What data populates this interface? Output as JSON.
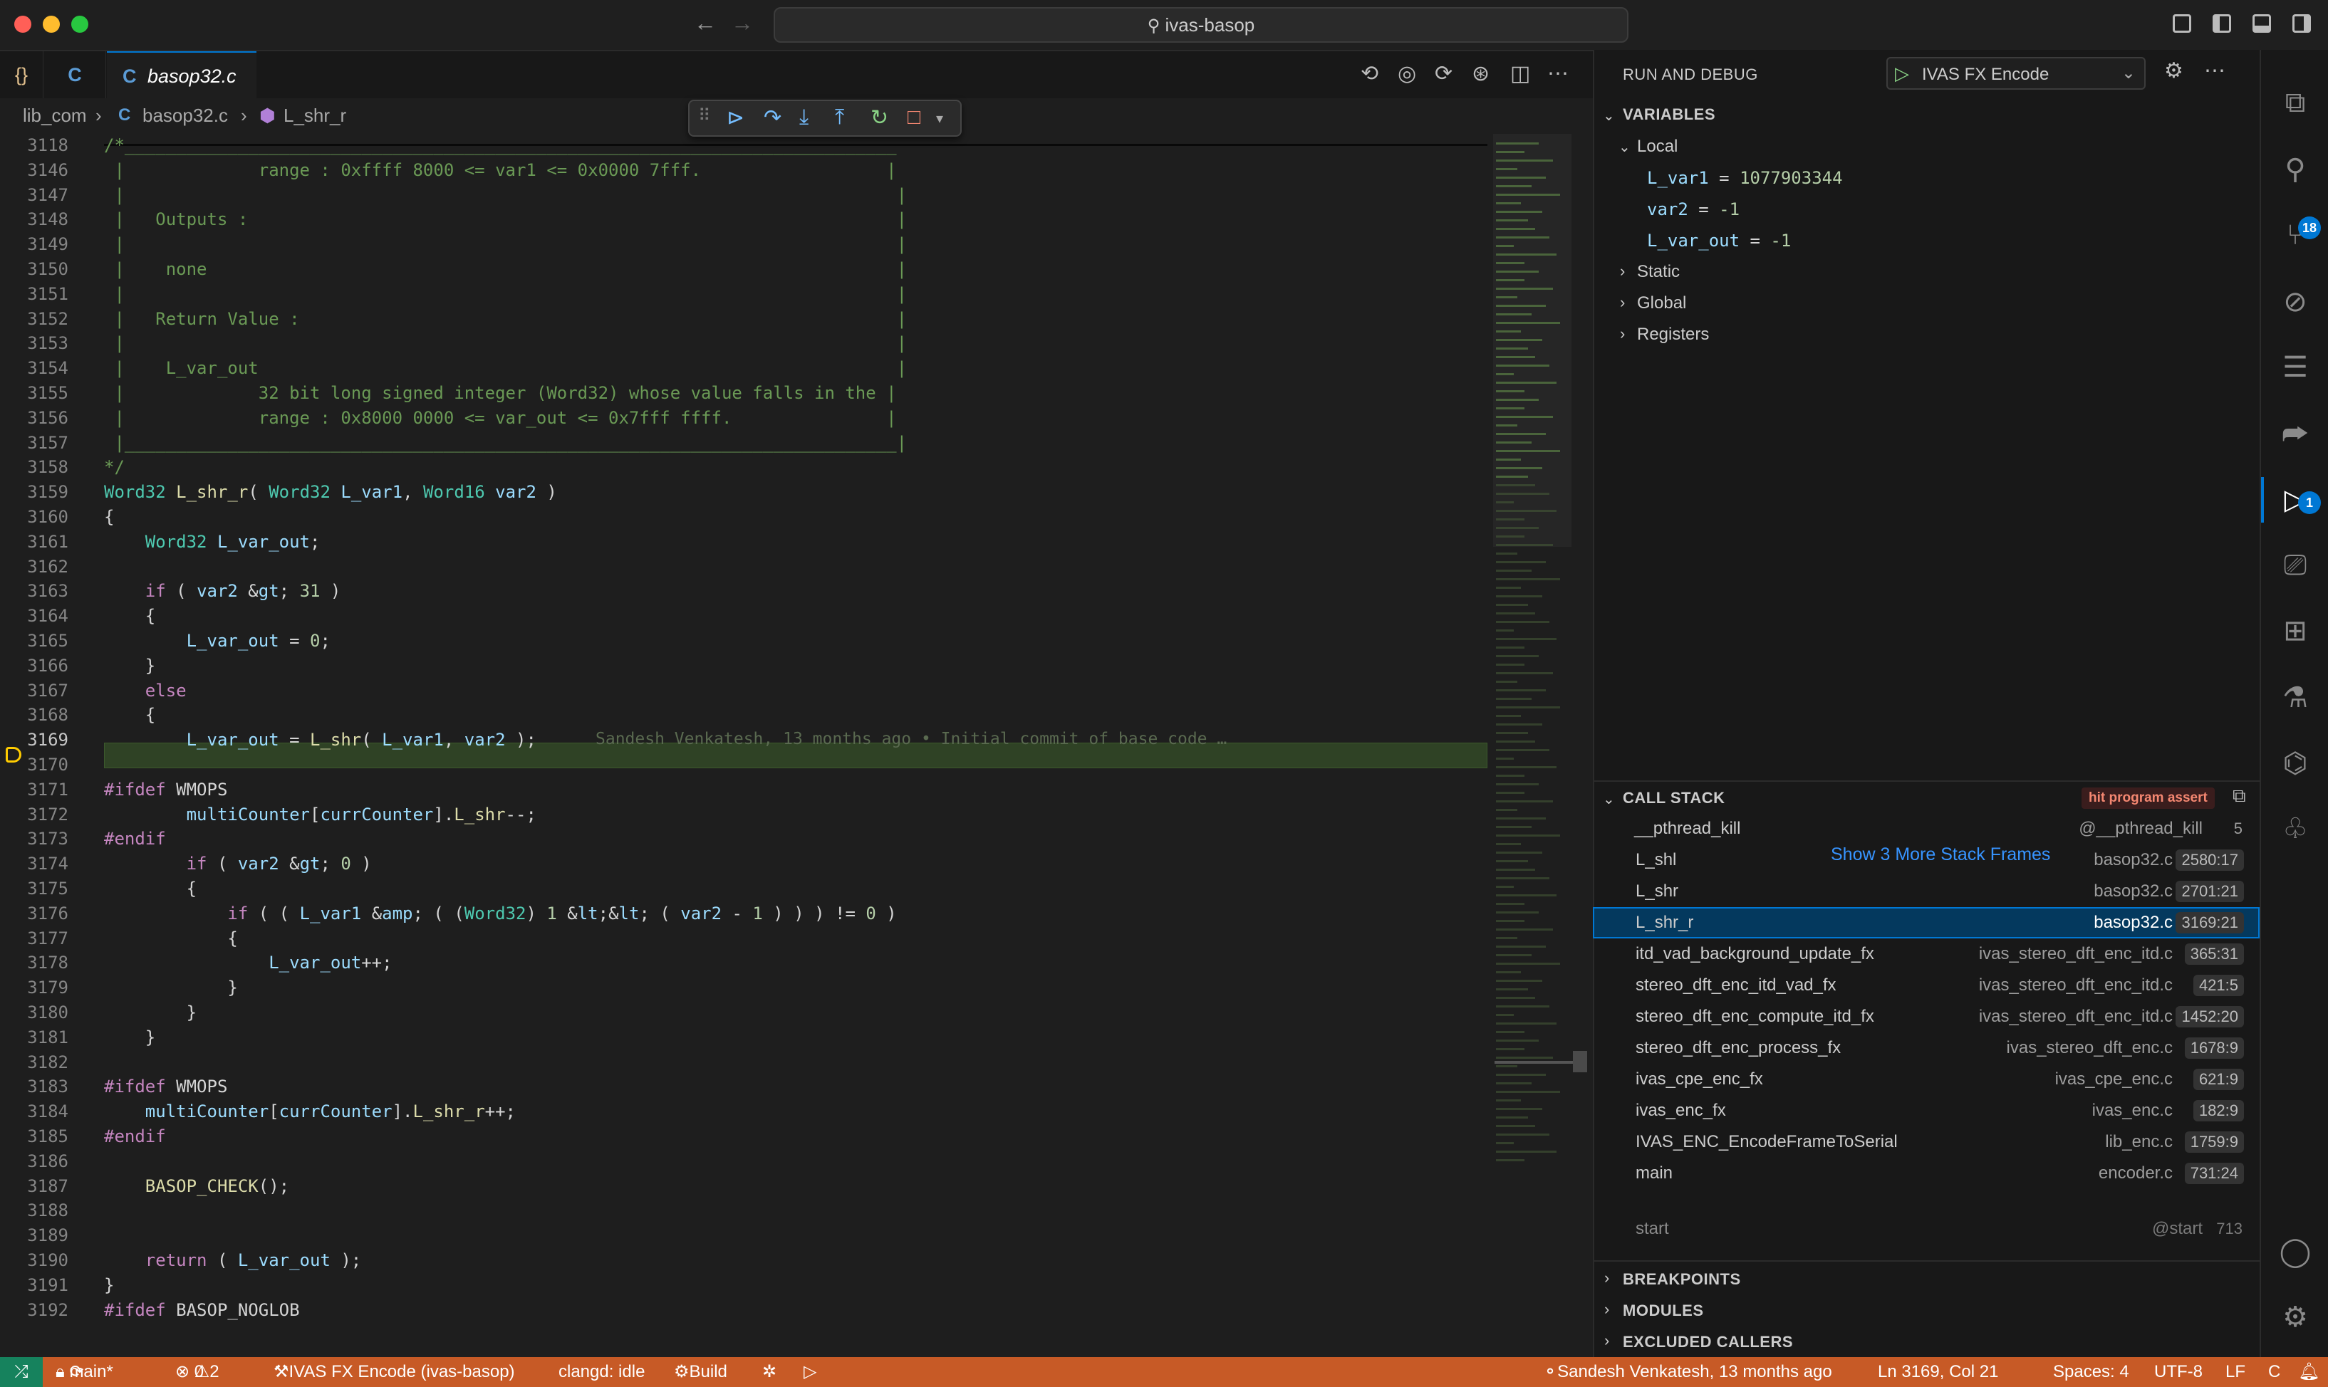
{
  "titlebar": {
    "search_text": "ivas-basop",
    "colors": {
      "close": "#ff5f57",
      "minimize": "#febc2e",
      "maximize": "#28c840"
    }
  },
  "tabs": [
    {
      "label": "{}"
    },
    {
      "label": "C"
    },
    {
      "label": "basop32.c"
    }
  ],
  "breadcrumb": {
    "folder": "lib_com",
    "file": "basop32.c",
    "symbol": "L_shr_r"
  },
  "editor": {
    "lines": [
      {
        "n": "3118",
        "t": "/*___________________________________________________________________________"
      },
      {
        "n": "3146",
        "t": " |             range : 0xffff 8000 <= var1 <= 0x0000 7fff.                  |"
      },
      {
        "n": "3147",
        "t": " |                                                                           |"
      },
      {
        "n": "3148",
        "t": " |   Outputs :                                                               |"
      },
      {
        "n": "3149",
        "t": " |                                                                           |"
      },
      {
        "n": "3150",
        "t": " |    none                                                                   |"
      },
      {
        "n": "3151",
        "t": " |                                                                           |"
      },
      {
        "n": "3152",
        "t": " |   Return Value :                                                          |"
      },
      {
        "n": "3153",
        "t": " |                                                                           |"
      },
      {
        "n": "3154",
        "t": " |    L_var_out                                                              |"
      },
      {
        "n": "3155",
        "t": " |             32 bit long signed integer (Word32) whose value falls in the |"
      },
      {
        "n": "3156",
        "t": " |             range : 0x8000 0000 <= var_out <= 0x7fff ffff.               |"
      },
      {
        "n": "3157",
        "t": " |___________________________________________________________________________|"
      },
      {
        "n": "3158",
        "t": "*/"
      },
      {
        "n": "3159",
        "t": "Word32 L_shr_r( Word32 L_var1, Word16 var2 )"
      },
      {
        "n": "3160",
        "t": "{"
      },
      {
        "n": "3161",
        "t": "    Word32 L_var_out;"
      },
      {
        "n": "3162",
        "t": ""
      },
      {
        "n": "3163",
        "t": "    if ( var2 > 31 )"
      },
      {
        "n": "3164",
        "t": "    {"
      },
      {
        "n": "3165",
        "t": "        L_var_out = 0;"
      },
      {
        "n": "3166",
        "t": "    }"
      },
      {
        "n": "3167",
        "t": "    else"
      },
      {
        "n": "3168",
        "t": "    {"
      },
      {
        "n": "3169",
        "t": "        L_var_out = L_shr( L_var1, var2 );"
      },
      {
        "n": "3170",
        "t": ""
      },
      {
        "n": "3171",
        "t": "#ifdef WMOPS"
      },
      {
        "n": "3172",
        "t": "        multiCounter[currCounter].L_shr--;"
      },
      {
        "n": "3173",
        "t": "#endif"
      },
      {
        "n": "3174",
        "t": "        if ( var2 > 0 )"
      },
      {
        "n": "3175",
        "t": "        {"
      },
      {
        "n": "3176",
        "t": "            if ( ( L_var1 & ( (Word32) 1 << ( var2 - 1 ) ) ) != 0 )"
      },
      {
        "n": "3177",
        "t": "            {"
      },
      {
        "n": "3178",
        "t": "                L_var_out++;"
      },
      {
        "n": "3179",
        "t": "            }"
      },
      {
        "n": "3180",
        "t": "        }"
      },
      {
        "n": "3181",
        "t": "    }"
      },
      {
        "n": "3182",
        "t": ""
      },
      {
        "n": "3183",
        "t": "#ifdef WMOPS"
      },
      {
        "n": "3184",
        "t": "    multiCounter[currCounter].L_shr_r++;"
      },
      {
        "n": "3185",
        "t": "#endif"
      },
      {
        "n": "3186",
        "t": ""
      },
      {
        "n": "3187",
        "t": "    BASOP_CHECK();"
      },
      {
        "n": "3188",
        "t": ""
      },
      {
        "n": "3189",
        "t": ""
      },
      {
        "n": "3190",
        "t": "    return ( L_var_out );"
      },
      {
        "n": "3191",
        "t": "}"
      },
      {
        "n": "3192",
        "t": "#ifdef BASOP_NOGLOB"
      }
    ],
    "blame": "Sandesh Venkatesh, 13 months ago • Initial commit of base code …"
  },
  "debug": {
    "panel_title": "RUN AND DEBUG",
    "config": "IVAS FX Encode",
    "variables": {
      "header": "VARIABLES",
      "local": "Local",
      "items": [
        {
          "name": "L_var1",
          "value": "1077903344"
        },
        {
          "name": "var2",
          "value": "-1"
        },
        {
          "name": "L_var_out",
          "value": "-1"
        }
      ],
      "groups": [
        "Static",
        "Global",
        "Registers"
      ]
    },
    "callstack": {
      "header": "CALL STACK",
      "status": "hit program assert",
      "show_more": "Show 3 More Stack Frames",
      "top": {
        "fn": "__pthread_kill",
        "file": "@__pthread_kill",
        "pos": "5"
      },
      "frames": [
        {
          "fn": "L_shl",
          "file": "basop32.c",
          "pos": "2580:17"
        },
        {
          "fn": "L_shr",
          "file": "basop32.c",
          "pos": "2701:21"
        },
        {
          "fn": "L_shr_r",
          "file": "basop32.c",
          "pos": "3169:21"
        },
        {
          "fn": "itd_vad_background_update_fx",
          "file": "ivas_stereo_dft_enc_itd.c",
          "pos": "365:31"
        },
        {
          "fn": "stereo_dft_enc_itd_vad_fx",
          "file": "ivas_stereo_dft_enc_itd.c",
          "pos": "421:5"
        },
        {
          "fn": "stereo_dft_enc_compute_itd_fx",
          "file": "ivas_stereo_dft_enc_itd.c",
          "pos": "1452:20"
        },
        {
          "fn": "stereo_dft_enc_process_fx",
          "file": "ivas_stereo_dft_enc.c",
          "pos": "1678:9"
        },
        {
          "fn": "ivas_cpe_enc_fx",
          "file": "ivas_cpe_enc.c",
          "pos": "621:9"
        },
        {
          "fn": "ivas_enc_fx",
          "file": "ivas_enc.c",
          "pos": "182:9"
        },
        {
          "fn": "IVAS_ENC_EncodeFrameToSerial",
          "file": "lib_enc.c",
          "pos": "1759:9"
        },
        {
          "fn": "main",
          "file": "encoder.c",
          "pos": "731:24"
        }
      ],
      "start": {
        "fn": "start",
        "file": "@start",
        "pos": "713"
      }
    },
    "sections": [
      "BREAKPOINTS",
      "MODULES",
      "EXCLUDED CALLERS"
    ]
  },
  "activity": {
    "scm_badge": "18",
    "debug_badge": "1"
  },
  "status": {
    "branch": "main*",
    "errors": "0",
    "warnings": "2",
    "launch": "IVAS FX Encode (ivas-basop)",
    "clangd": "clangd: idle",
    "build": "Build",
    "blame": "Sandesh Venkatesh, 13 months ago",
    "position": "Ln 3169, Col 21",
    "spaces": "Spaces: 4",
    "encoding": "UTF-8",
    "eol": "LF",
    "language": "C"
  }
}
